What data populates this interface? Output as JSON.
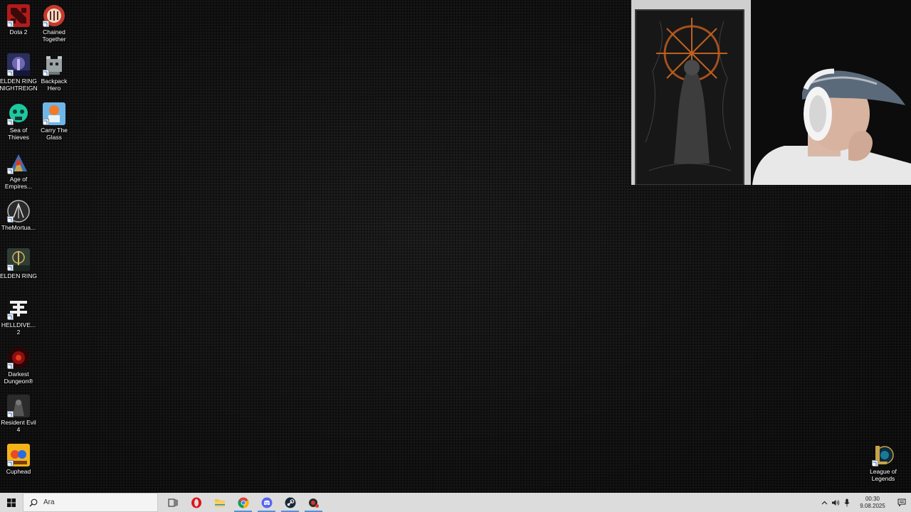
{
  "desktop": {
    "icons": [
      {
        "label": "Dota 2",
        "icon": "dota2-icon"
      },
      {
        "label": "Chained\nTogether",
        "icon": "chained-together-icon"
      },
      {
        "label": "ELDEN RING\nNIGHTREIGN",
        "icon": "elden-ring-nightreign-icon"
      },
      {
        "label": "Backpack\nHero",
        "icon": "backpack-hero-icon"
      },
      {
        "label": "Sea of\nThieves",
        "icon": "sea-of-thieves-icon"
      },
      {
        "label": "Carry The\nGlass",
        "icon": "carry-the-glass-icon"
      },
      {
        "label": "Age of\nEmpires...",
        "icon": "age-of-empires-icon"
      },
      {
        "label": "TheMortua...",
        "icon": "the-mortuary-icon"
      },
      {
        "label": "ELDEN RING",
        "icon": "elden-ring-icon"
      },
      {
        "label": "HELLDIVE...\n2",
        "icon": "helldivers-2-icon"
      },
      {
        "label": "Darkest\nDungeon®",
        "icon": "darkest-dungeon-icon"
      },
      {
        "label": "Resident Evil\n4",
        "icon": "resident-evil-4-icon"
      },
      {
        "label": "Cuphead",
        "icon": "cuphead-icon"
      },
      {
        "label": "League of\nLegends",
        "icon": "league-of-legends-icon"
      }
    ]
  },
  "taskbar": {
    "search_placeholder": "Ara",
    "apps": [
      {
        "name": "task-view",
        "icon": "task-view-icon"
      },
      {
        "name": "opera",
        "icon": "opera-icon"
      },
      {
        "name": "file-explorer",
        "icon": "folder-icon"
      },
      {
        "name": "chrome",
        "icon": "chrome-icon"
      },
      {
        "name": "discord",
        "icon": "discord-icon"
      },
      {
        "name": "steam",
        "icon": "steam-icon"
      },
      {
        "name": "record",
        "icon": "record-app-icon"
      }
    ],
    "clock": {
      "time": "00:30",
      "date": "9.08.2025"
    }
  },
  "colors": {
    "taskbar_bg": "#dcdcdc",
    "desktop_bg": "#111111",
    "accent": "#5a8fd6"
  }
}
